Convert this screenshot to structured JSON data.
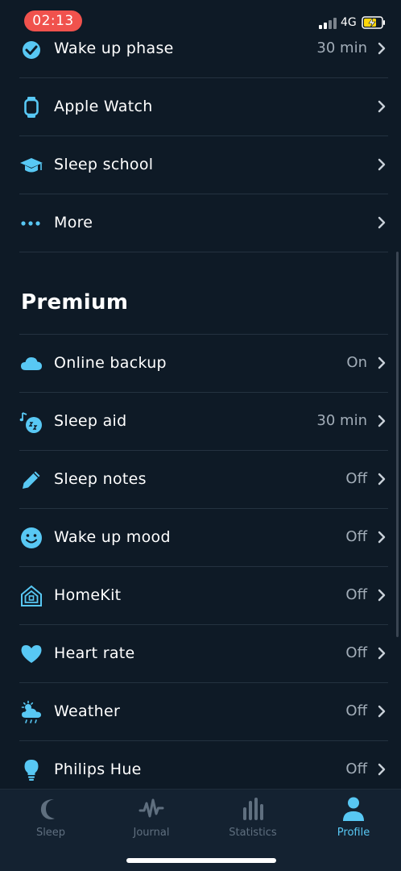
{
  "status_bar": {
    "time": "02:13",
    "network": "4G"
  },
  "rows_top": [
    {
      "label": "Wake up phase",
      "value": "30 min",
      "icon": "alarm-check-icon"
    },
    {
      "label": "Apple Watch",
      "value": "",
      "icon": "watch-icon"
    },
    {
      "label": "Sleep school",
      "value": "",
      "icon": "graduation-cap-icon"
    },
    {
      "label": "More",
      "value": "",
      "icon": "ellipsis-icon"
    }
  ],
  "premium": {
    "title": "Premium",
    "rows": [
      {
        "label": "Online backup",
        "value": "On",
        "icon": "cloud-icon"
      },
      {
        "label": "Sleep aid",
        "value": "30 min",
        "icon": "music-moon-icon"
      },
      {
        "label": "Sleep notes",
        "value": "Off",
        "icon": "pencil-icon"
      },
      {
        "label": "Wake up mood",
        "value": "Off",
        "icon": "smiley-icon"
      },
      {
        "label": "HomeKit",
        "value": "Off",
        "icon": "home-icon"
      },
      {
        "label": "Heart rate",
        "value": "Off",
        "icon": "heart-icon"
      },
      {
        "label": "Weather",
        "value": "Off",
        "icon": "weather-icon"
      },
      {
        "label": "Philips Hue",
        "value": "Off",
        "icon": "lightbulb-icon"
      }
    ]
  },
  "tabs": [
    {
      "label": "Sleep",
      "icon": "moon-icon",
      "active": false
    },
    {
      "label": "Journal",
      "icon": "pulse-icon",
      "active": false
    },
    {
      "label": "Statistics",
      "icon": "bar-chart-icon",
      "active": false
    },
    {
      "label": "Profile",
      "icon": "person-icon",
      "active": true
    }
  ],
  "colors": {
    "accent": "#58c8f4",
    "background": "#0e1a26",
    "status_pill": "#f0524d",
    "tab_inactive": "#5f6f7f",
    "value_text": "#a2adb8"
  }
}
